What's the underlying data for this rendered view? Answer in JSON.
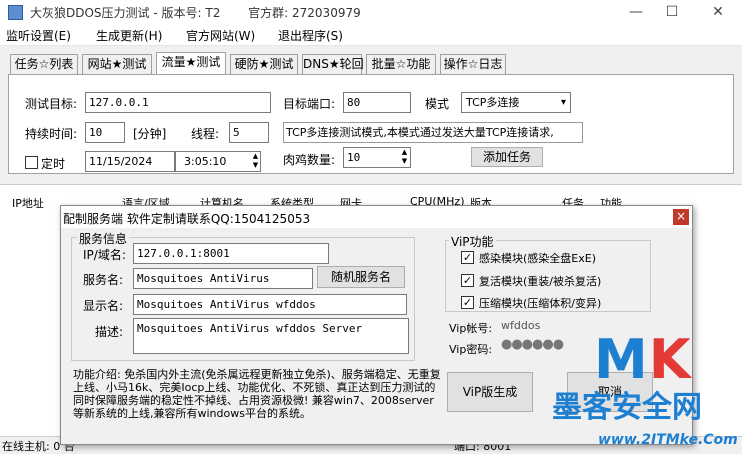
{
  "window": {
    "title": "大灰狼DDOS压力测试 - 版本号: T2",
    "qq_label": "官方群: 272030979",
    "controls": {
      "minimize": "—",
      "maximize": "☐",
      "close": "✕"
    }
  },
  "menu": [
    "监听设置(E)",
    "生成更新(H)",
    "官方网站(W)",
    "退出程序(S)"
  ],
  "tabs": [
    {
      "label": "任务☆列表",
      "active": false
    },
    {
      "label": "网站★测试",
      "active": false
    },
    {
      "label": "流量★测试",
      "active": true
    },
    {
      "label": "硬防★测试",
      "active": false
    },
    {
      "label": "DNS★轮回",
      "active": false
    },
    {
      "label": "批量☆功能",
      "active": false
    },
    {
      "label": "操作☆日志",
      "active": false
    }
  ],
  "form": {
    "target_label": "测试目标:",
    "target_value": "127.0.0.1",
    "port_label": "目标端口:",
    "port_value": "80",
    "mode_label": "模式",
    "mode_value": "TCP多连接",
    "duration_label": "持续时间:",
    "duration_value": "10",
    "duration_unit": "[分钟]",
    "threads_label": "线程:",
    "threads_value": "5",
    "description": "TCP多连接测试模式,本模式通过发送大量TCP连接请求,",
    "timer_label": "定时",
    "date_value": "11/15/2024",
    "time_value": "3:05:10",
    "bots_label": "肉鸡数量:",
    "bots_value": "10",
    "add_task_button": "添加任务"
  },
  "table_headers": [
    "IP地址",
    "语言/区域",
    "计算机名",
    "系统类型",
    "网卡",
    "CPU(MHz)",
    "版本",
    "任务",
    "功能"
  ],
  "status": {
    "online": "在线主机: 0 台",
    "port": "端口: 8001"
  },
  "dialog": {
    "title": "配制服务端  软件定制请联系QQ:1504125053",
    "close": "×",
    "service_group": "服务信息",
    "ip_label": "IP/域名:",
    "ip_value": "127.0.0.1:8001",
    "service_name_label": "服务名:",
    "service_name_value": "Mosquitoes AntiVirus",
    "random_button": "随机服务名",
    "display_label": "显示名:",
    "display_value": "Mosquitoes AntiVirus wfddos",
    "desc_label": "描述:",
    "desc_value": "Mosquitoes AntiVirus wfddos Server",
    "vip_group": "ViP功能",
    "vip_options": [
      {
        "label": "感染模块(感染全盘ExE)",
        "checked": true
      },
      {
        "label": "复活模块(重装/被杀复活)",
        "checked": true
      },
      {
        "label": "压缩模块(压缩体积/变异)",
        "checked": true
      }
    ],
    "vip_account_label": "Vip帐号:",
    "vip_account_value": "wfddos",
    "vip_password_label": "Vip密码:",
    "vip_password_value": "●●●●●●",
    "intro": "功能介绍: 免杀国内外主流(免杀属远程更新独立免杀)、服务端稳定、无重复上线、小马16k、完美Iocp上线、功能优化、不死锁、真正达到压力测试的同时保障服务端的稳定性不掉线、占用资源极微! 兼容win7、2008server等新系统的上线,兼容所有windows平台的系统。",
    "generate_button": "ViP版生成",
    "cancel_button": "取消"
  },
  "watermark": {
    "mk": "MK",
    "cn": "墨客安全网",
    "url": "www.2ITMke.Com"
  }
}
